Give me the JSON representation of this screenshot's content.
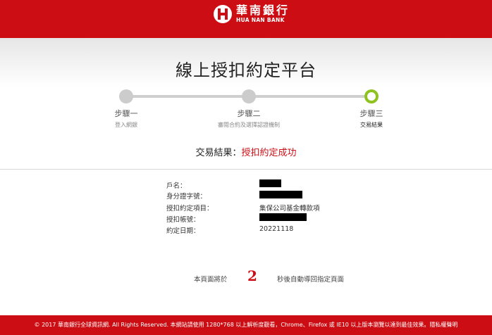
{
  "header": {
    "brand_cn": "華南銀行",
    "brand_en": "HUA NAN BANK",
    "logo_icon": "hua-nan-logo-icon",
    "brand_color": "#cc0e14"
  },
  "page": {
    "title": "線上授扣約定平台"
  },
  "steps": [
    {
      "label": "步驟一",
      "sub": "登入網銀",
      "active": false
    },
    {
      "label": "步驟二",
      "sub": "審閱合約及選擇認證機制",
      "active": false
    },
    {
      "label": "步驟三",
      "sub": "交易結果",
      "active": true
    }
  ],
  "step_active_color": "#8dc21f",
  "result": {
    "prefix": "交易結果：",
    "status": "授扣約定成功"
  },
  "details": {
    "name_label": "戶名：",
    "id_label": "身分證字號：",
    "item_label": "授扣約定項目：",
    "item_value": "集保公司基金轉款項",
    "account_label": "授扣帳號：",
    "date_label": "約定日期：",
    "date_value": "20221118"
  },
  "countdown": {
    "prefix": "本頁面將於",
    "seconds": "2",
    "suffix": "秒後自動導回指定頁面"
  },
  "footer": {
    "text": "© 2017 華南銀行全球資訊網. All Rights Reserved. 本網站請使用 1280*768 以上解析度觀看，Chrome、Firefox 或 IE10 以上版本瀏覽以達到最佳效果。",
    "privacy_link": "隱私權聲明"
  }
}
